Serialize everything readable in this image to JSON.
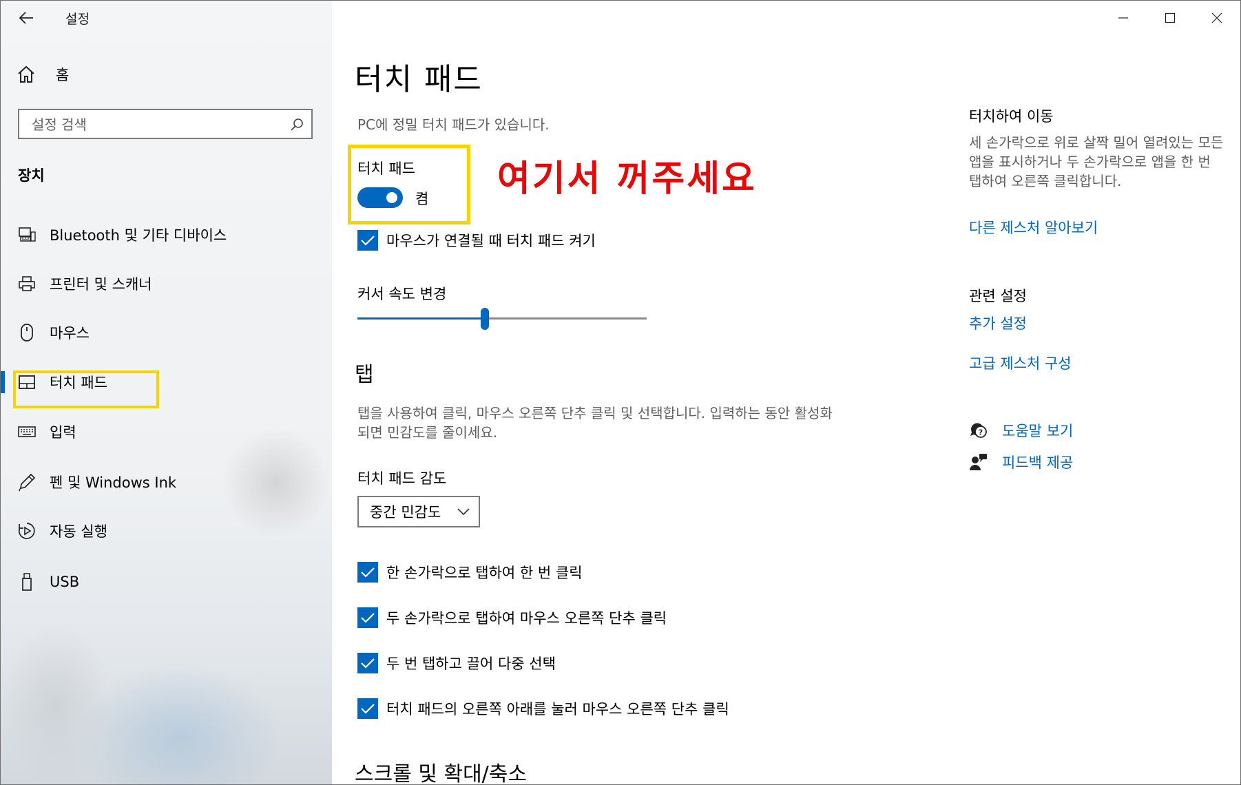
{
  "window": {
    "title": "설정",
    "controls": {
      "minimize_icon": "minimize-icon",
      "maximize_icon": "maximize-icon",
      "close_icon": "close-icon"
    }
  },
  "sidebar": {
    "home_label": "홈",
    "search_placeholder": "설정 검색",
    "section": "장치",
    "items": [
      {
        "label": "Bluetooth 및 기타 디바이스",
        "icon": "bluetooth-devices-icon"
      },
      {
        "label": "프린터 및 스캐너",
        "icon": "printer-icon"
      },
      {
        "label": "마우스",
        "icon": "mouse-icon"
      },
      {
        "label": "터치 패드",
        "icon": "touchpad-icon",
        "selected": true
      },
      {
        "label": "입력",
        "icon": "keyboard-icon"
      },
      {
        "label": "펜 및 Windows Ink",
        "icon": "pen-icon"
      },
      {
        "label": "자동 실행",
        "icon": "autoplay-icon"
      },
      {
        "label": "USB",
        "icon": "usb-icon"
      }
    ]
  },
  "main": {
    "title": "터치 패드",
    "precision_desc": "PC에 정밀 터치 패드가 있습니다.",
    "toggle": {
      "title": "터치 패드",
      "state": "켬",
      "on": true
    },
    "annotation": "여기서 꺼주세요",
    "mouse_connected_check": {
      "label": "마우스가 연결될 때 터치 패드 켜기",
      "checked": true
    },
    "cursor_speed": {
      "label": "커서 속도 변경",
      "value_fraction": 0.44
    },
    "taps": {
      "title": "탭",
      "description": "탭을 사용하여 클릭, 마우스 오른쪽 단추 클릭 및 선택합니다. 입력하는 동안 활성화되면 민감도를 줄이세요.",
      "sensitivity_label": "터치 패드 감도",
      "sensitivity_value": "중간 민감도",
      "options": [
        {
          "label": "한 손가락으로 탭하여 한 번 클릭",
          "checked": true
        },
        {
          "label": "두 손가락으로 탭하여 마우스 오른쪽 단추 클릭",
          "checked": true
        },
        {
          "label": "두 번 탭하고 끌어 다중 선택",
          "checked": true
        },
        {
          "label": "터치 패드의 오른쪽 아래를 눌러 마우스 오른쪽 단추 클릭",
          "checked": true
        }
      ]
    },
    "scroll_title": "스크롤 및 확대/축소"
  },
  "right": {
    "gesture_head": "터치하여 이동",
    "gesture_desc": "세 손가락으로 위로 살짝 밀어 열려있는 모든 앱을 표시하거나 두 손가락으로 앱을 한 번 탭하여 오른쪽 클릭합니다.",
    "gesture_link": "다른 제스처 알아보기",
    "related_head": "관련 설정",
    "related_links": [
      "추가 설정",
      "고급 제스처 구성"
    ],
    "help_label": "도움말 보기",
    "feedback_label": "피드백 제공"
  },
  "colors": {
    "accent": "#0067c0",
    "highlight": "#f5d400",
    "annotation": "#e30a0a"
  }
}
